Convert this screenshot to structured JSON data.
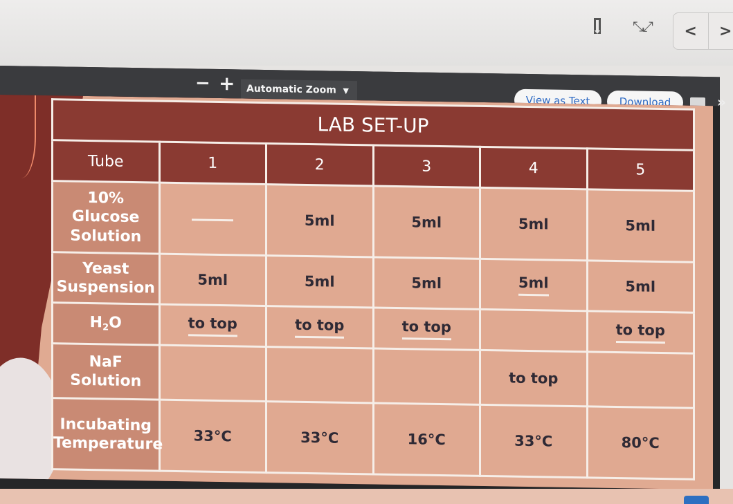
{
  "browser": {
    "bookmark_icon": "bookmark-icon",
    "expand_icon": "expand-icon",
    "back_label": "<",
    "forward_label": ">"
  },
  "pdf_toolbar": {
    "zoom_out_label": "−",
    "zoom_in_label": "+",
    "zoom_value": "Automatic Zoom",
    "view_as_text_label": "View as Text",
    "download_label": "Download",
    "more_label": "»"
  },
  "slide": {
    "title": "LAB SET-UP",
    "header": [
      "Tube",
      "1",
      "2",
      "3",
      "4",
      "5"
    ],
    "rows": [
      {
        "label": "10% Glucose Solution",
        "cells": [
          "—",
          "5ml",
          "5ml",
          "5ml",
          "5ml"
        ]
      },
      {
        "label": "Yeast Suspension",
        "cells": [
          "5ml",
          "5ml",
          "5ml",
          "5ml",
          "5ml"
        ]
      },
      {
        "label_main": "H",
        "label_sub": "2",
        "label_end": "O",
        "cells": [
          "to top",
          "to top",
          "to top",
          "",
          "to top"
        ]
      },
      {
        "label": "NaF Solution",
        "cells": [
          "",
          "",
          "",
          "to top",
          ""
        ]
      },
      {
        "label": "Incubating Temperature",
        "cells": [
          "33°C",
          "33°C",
          "16°C",
          "33°C",
          "80°C"
        ]
      }
    ]
  }
}
